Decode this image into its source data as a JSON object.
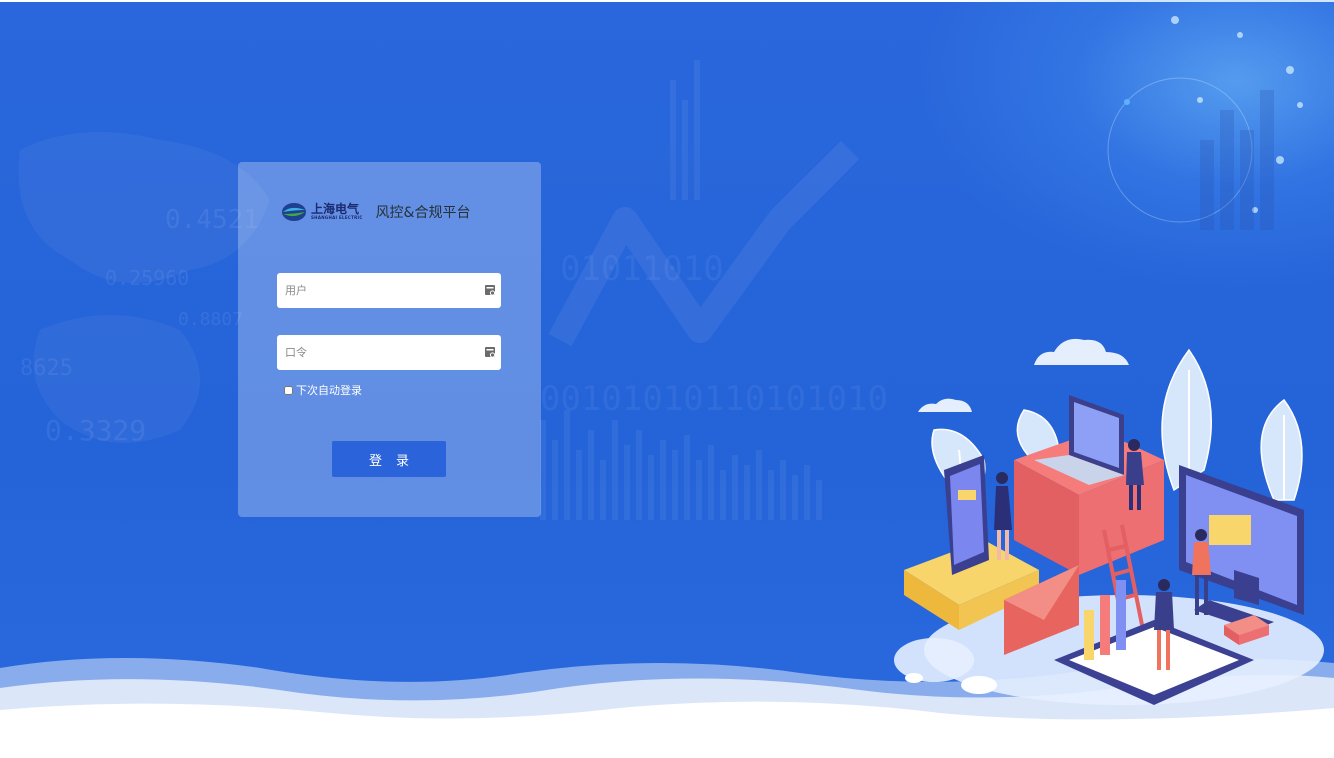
{
  "brand": {
    "logo_text": "上海电气",
    "logo_subtext": "SHANGHAI ELECTRIC",
    "platform_title": "风控&合规平台"
  },
  "login_form": {
    "username_placeholder": "用户",
    "password_placeholder": "口令",
    "remember_label": "下次自动登录",
    "remember_checked": false,
    "submit_label": "登录"
  },
  "icons": {
    "username_field_icon": "key-card-icon",
    "password_field_icon": "key-card-icon",
    "logo": "shanghai-electric-logo-icon"
  },
  "colors": {
    "background": "#2463d8",
    "button": "#2a63da",
    "card_overlay": "rgba(255,255,255,0.28)",
    "wave": "#ffffff"
  }
}
